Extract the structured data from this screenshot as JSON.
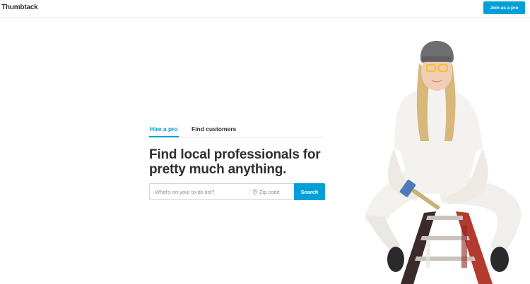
{
  "header": {
    "logo": "Thumbtack",
    "join_button": "Join as a pro"
  },
  "tabs": [
    {
      "label": "Hire a pro",
      "active": true
    },
    {
      "label": "Find customers",
      "active": false
    }
  ],
  "hero": {
    "headline_line1": "Find local professionals for",
    "headline_line2": "pretty much anything."
  },
  "search": {
    "task_placeholder": "What's on your to-do list?",
    "zip_placeholder": "Zip code",
    "button_label": "Search"
  },
  "colors": {
    "accent": "#009fd9",
    "text": "#2f3033"
  },
  "icons": [
    "map-pin-icon"
  ]
}
